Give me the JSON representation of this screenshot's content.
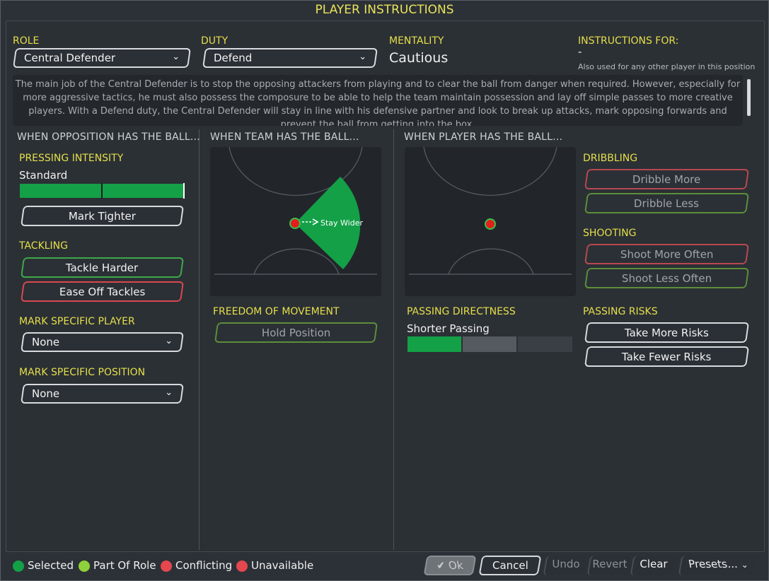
{
  "window": {
    "title": "PLAYER INSTRUCTIONS"
  },
  "header": {
    "role_label": "ROLE",
    "role_value": "Central Defender",
    "duty_label": "DUTY",
    "duty_value": "Defend",
    "mentality_label": "MENTALITY",
    "mentality_value": "Cautious",
    "instructions_for_label": "INSTRUCTIONS FOR:",
    "instructions_for_value": "-",
    "instructions_for_note": "Also used for any other player in this position",
    "description": "The main job of the Central Defender is to stop the opposing attackers from playing and to clear the ball from danger when required. However, especially for more aggressive tactics, he must also possess the composure to be able to help the team maintain possession and lay off simple passes to more creative players. With a Defend duty, the Central Defender will stay in line with his defensive partner and look to break up attacks, mark opposing forwards and prevent the ball from getting into the box."
  },
  "opposition": {
    "section_title": "WHEN OPPOSITION HAS THE BALL...",
    "pressing_label": "PRESSING INTENSITY",
    "pressing_value": "Standard",
    "pressing_level": 1.0,
    "mark_tighter": "Mark Tighter",
    "tackling_label": "TACKLING",
    "tackle_harder": "Tackle Harder",
    "ease_off_tackles": "Ease Off Tackles",
    "mark_player_label": "MARK SPECIFIC PLAYER",
    "mark_player_value": "None",
    "mark_position_label": "MARK SPECIFIC POSITION",
    "mark_position_value": "None"
  },
  "team": {
    "section_title": "WHEN TEAM HAS THE BALL...",
    "pitch_annotation": "Stay Wider",
    "freedom_label": "FREEDOM OF MOVEMENT",
    "hold_position": "Hold Position"
  },
  "player": {
    "section_title": "WHEN PLAYER HAS THE BALL...",
    "dribbling_label": "DRIBBLING",
    "dribble_more": "Dribble More",
    "dribble_less": "Dribble Less",
    "shooting_label": "SHOOTING",
    "shoot_more": "Shoot More Often",
    "shoot_less": "Shoot Less Often",
    "passing_directness_label": "PASSING DIRECTNESS",
    "passing_directness_value": "Shorter Passing",
    "passing_directness_level": 0.33,
    "passing_risks_label": "PASSING RISKS",
    "take_more_risks": "Take More Risks",
    "take_fewer_risks": "Take Fewer Risks"
  },
  "legend": {
    "selected": "Selected",
    "part_of_role": "Part Of Role",
    "conflicting": "Conflicting",
    "unavailable": "Unavailable"
  },
  "footer": {
    "ok": "Ok",
    "cancel": "Cancel",
    "undo": "Undo",
    "revert": "Revert",
    "clear": "Clear",
    "presets": "Presets..."
  },
  "colors": {
    "accent_yellow": "#e6df4a",
    "selected_green": "#14a047",
    "part_of_role": "#8fd13a",
    "conflicting": "#e5474f",
    "unavailable": "#e5474f"
  }
}
